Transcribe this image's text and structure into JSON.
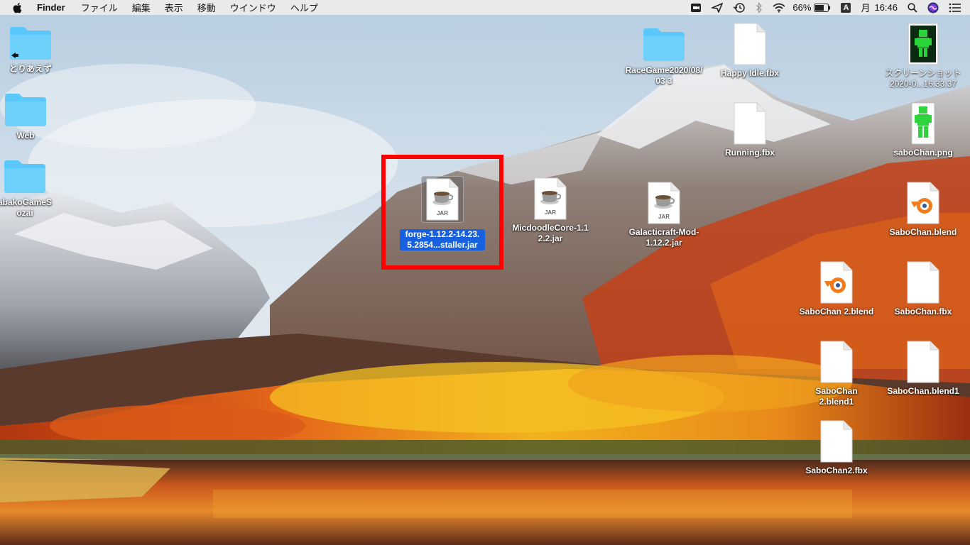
{
  "menubar": {
    "apple_icon": "apple-icon",
    "app_name": "Finder",
    "menus": [
      "ファイル",
      "編集",
      "表示",
      "移動",
      "ウインドウ",
      "ヘルプ"
    ],
    "battery_percent": "66%",
    "ime_label": "A",
    "day": "月",
    "time": "16:46",
    "status_icons": [
      "camera-icon",
      "location-icon",
      "time-machine-icon",
      "bluetooth-icon",
      "wifi-icon",
      "battery-icon",
      "spotlight-icon",
      "siri-icon",
      "notification-center-icon"
    ]
  },
  "desktop": {
    "items": [
      {
        "label": "とりあえず",
        "kind": "folder-alias"
      },
      {
        "label": "Web",
        "kind": "folder"
      },
      {
        "label": "abakoGameSozai",
        "kind": "folder"
      },
      {
        "label": "RaceGame2020/08/03 3",
        "kind": "folder"
      },
      {
        "label": "Happy Idle.fbx",
        "kind": "document"
      },
      {
        "label": "スクリーンショット 2020-0...16.33.37",
        "kind": "image-thumbnail"
      },
      {
        "label": "Running.fbx",
        "kind": "document"
      },
      {
        "label": "saboChan.png",
        "kind": "image-thumbnail"
      },
      {
        "label": "forge-1.12.2-14.23.5.2854...staller.jar",
        "kind": "jar",
        "selected": true
      },
      {
        "label": "MicdoodleCore-1.12.2.jar",
        "kind": "jar"
      },
      {
        "label": "Galacticraft-Mod-1.12.2.jar",
        "kind": "jar"
      },
      {
        "label": "SaboChan.blend",
        "kind": "blender"
      },
      {
        "label": "SaboChan 2.blend",
        "kind": "blender"
      },
      {
        "label": "SaboChan.fbx",
        "kind": "document"
      },
      {
        "label": "SaboChan 2.blend1",
        "kind": "document"
      },
      {
        "label": "SaboChan.blend1",
        "kind": "document"
      },
      {
        "label": "SaboChan2.fbx",
        "kind": "document"
      }
    ],
    "jar_badge": "JAR"
  },
  "colors": {
    "selection": "#1761e0",
    "highlight_box": "#ff0000",
    "folder": "#5ac8fa"
  }
}
